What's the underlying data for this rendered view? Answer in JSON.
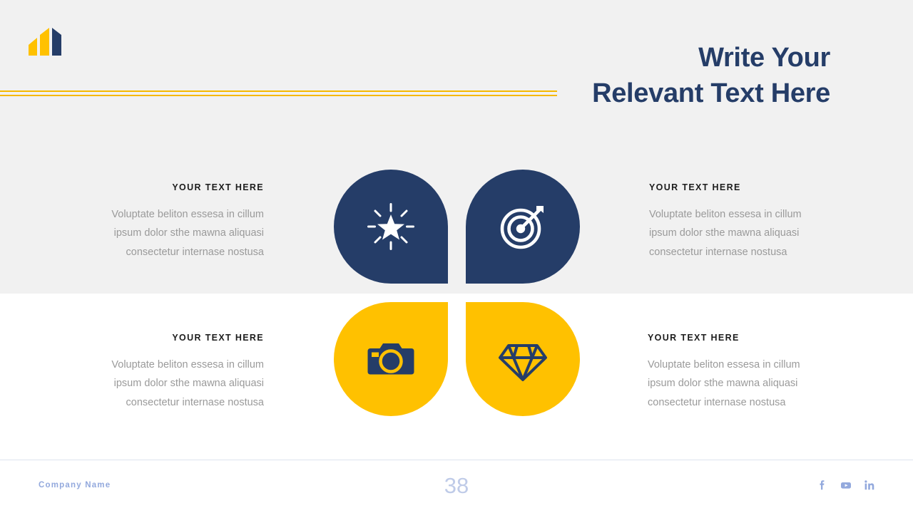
{
  "theme": {
    "navy": "#253d68",
    "gold": "#ffc100",
    "rule_yellow": "#f5b800",
    "band_gray": "#f1f1f1",
    "body_gray": "#9a9a9a",
    "footer_blue": "#93a9dd",
    "pagenum_blue": "#bfcbe8"
  },
  "logo": {
    "name": "bar-chart-logo"
  },
  "header": {
    "title_line_1": "Write Your",
    "title_line_2": "Relevant Text Here"
  },
  "blocks": [
    {
      "heading": "YOUR TEXT HERE",
      "body_line_1": "Voluptate beliton essesa in cillum",
      "body_line_2": "ipsum dolor sthe mawna aliquasi",
      "body_line_3": "consectetur internase nostusa",
      "align": "right"
    },
    {
      "heading": "YOUR TEXT HERE",
      "body_line_1": "Voluptate beliton essesa in cillum",
      "body_line_2": "ipsum dolor sthe mawna aliquasi",
      "body_line_3": "consectetur internase nostusa",
      "align": "left"
    },
    {
      "heading": "YOUR TEXT HERE",
      "body_line_1": "Voluptate beliton essesa in cillum",
      "body_line_2": "ipsum dolor sthe mawna aliquasi",
      "body_line_3": "consectetur internase nostusa",
      "align": "right"
    },
    {
      "heading": "YOUR TEXT HERE",
      "body_line_1": "Voluptate beliton essesa in cillum",
      "body_line_2": "ipsum dolor sthe mawna aliquasi",
      "body_line_3": "consectetur internase nostusa",
      "align": "left"
    }
  ],
  "shapes": [
    {
      "icon": "star-burst-icon",
      "fill": "#253d68",
      "glyph_color": "#ffffff",
      "corner": "bottom-right"
    },
    {
      "icon": "target-arrow-icon",
      "fill": "#253d68",
      "glyph_color": "#ffffff",
      "corner": "bottom-left"
    },
    {
      "icon": "camera-icon",
      "fill": "#ffc100",
      "glyph_color": "#253d68",
      "corner": "top-right"
    },
    {
      "icon": "diamond-icon",
      "fill": "#ffc100",
      "glyph_color": "#253d68",
      "corner": "top-left"
    }
  ],
  "footer": {
    "company": "Company Name",
    "page_number": "38",
    "socials": [
      {
        "name": "facebook-icon",
        "label": "f"
      },
      {
        "name": "youtube-icon",
        "label": "YouTube"
      },
      {
        "name": "linkedin-icon",
        "label": "in"
      }
    ]
  }
}
